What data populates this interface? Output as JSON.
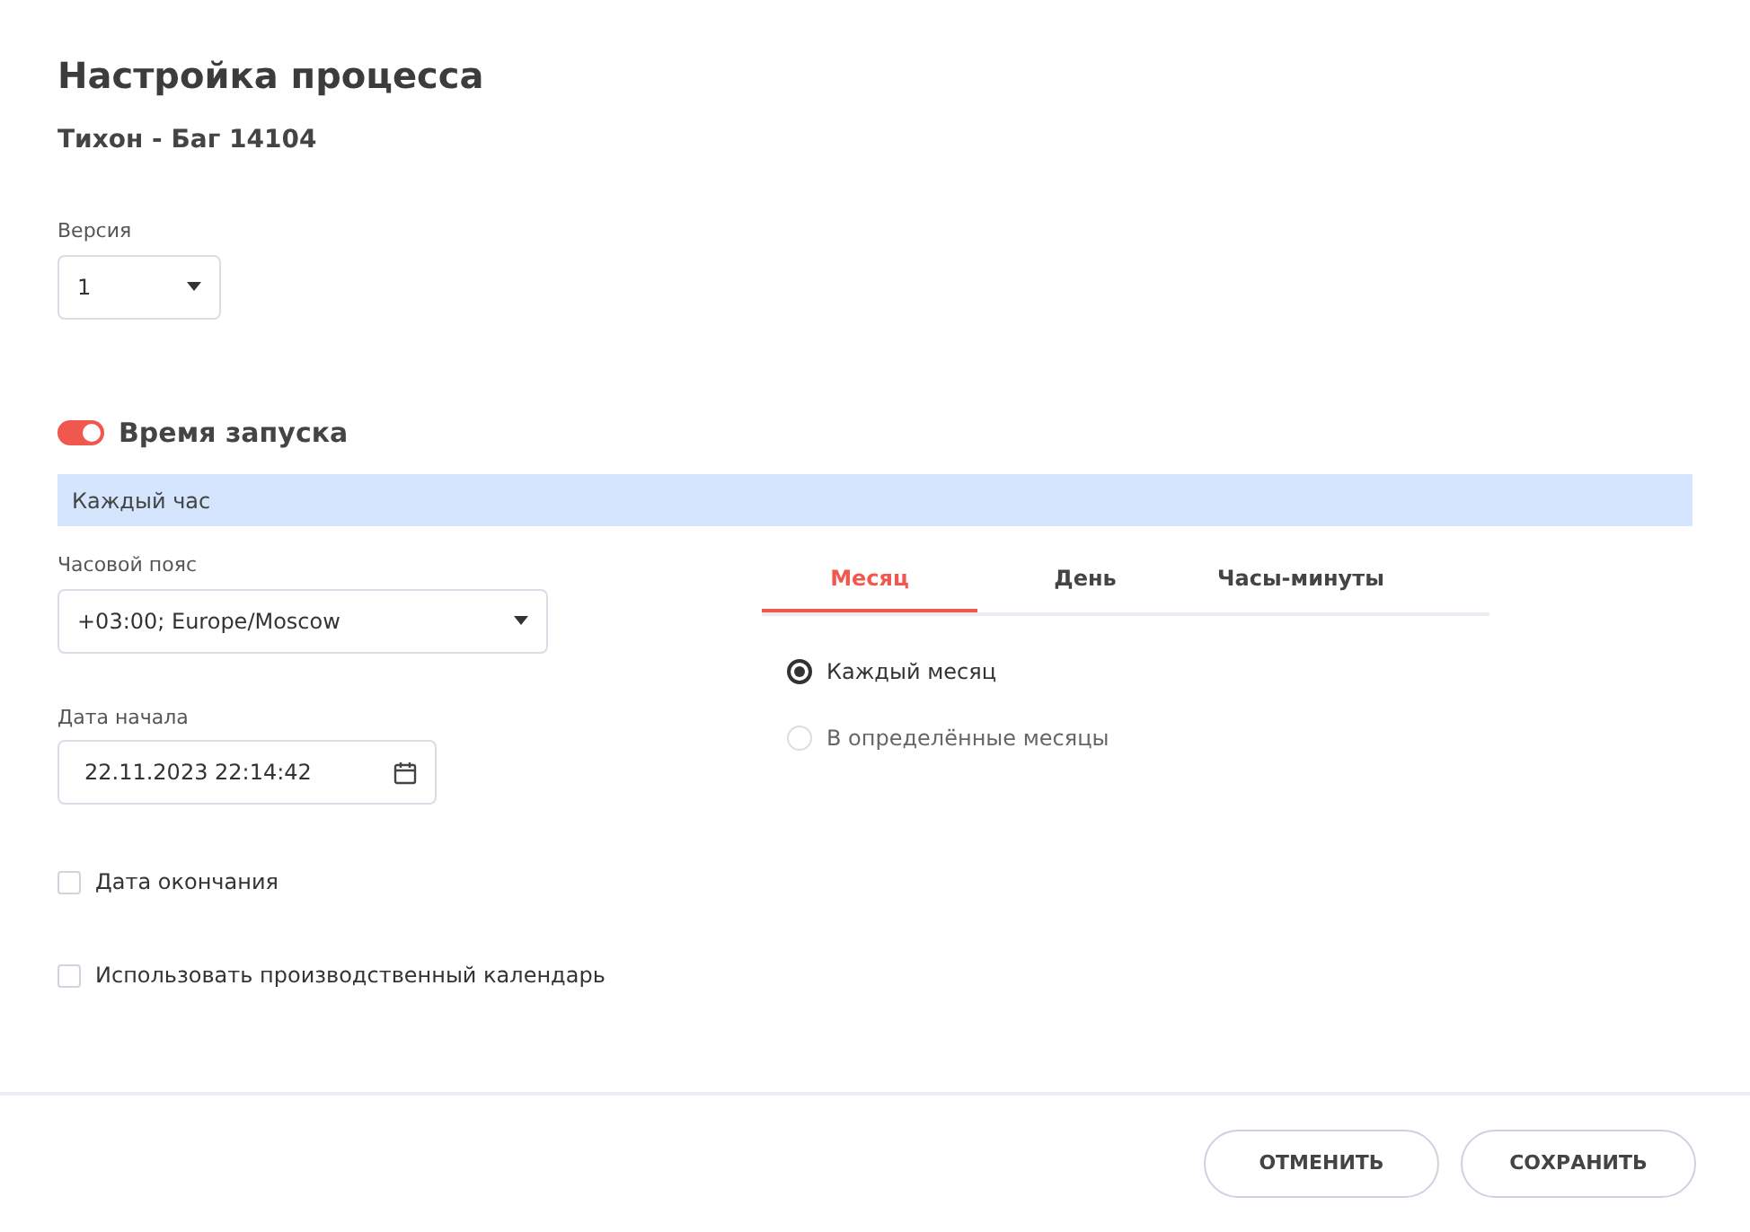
{
  "title": "Настройка процесса",
  "subtitle": "Тихон - Баг 14104",
  "version": {
    "label": "Версия",
    "value": "1"
  },
  "schedule": {
    "label": "Время запуска",
    "on": true,
    "summary": "Каждый час"
  },
  "timezone": {
    "label": "Часовой пояс",
    "value": "+03:00; Europe/Moscow"
  },
  "start_date": {
    "label": "Дата начала",
    "value": "22.11.2023 22:14:42"
  },
  "checkboxes": [
    {
      "label": "Дата окончания",
      "checked": false
    },
    {
      "label": "Использовать производственный календарь",
      "checked": false
    }
  ],
  "tabs": [
    {
      "label": "Месяц",
      "selected": true
    },
    {
      "label": "День",
      "selected": false
    },
    {
      "label": "Часы-минуты",
      "selected": false
    }
  ],
  "radios": [
    {
      "label": "Каждый месяц",
      "selected": true
    },
    {
      "label": "В определённые месяцы",
      "selected": false
    }
  ],
  "buttons": [
    "ОТМЕНИТЬ",
    "СОХРАНИТЬ"
  ]
}
